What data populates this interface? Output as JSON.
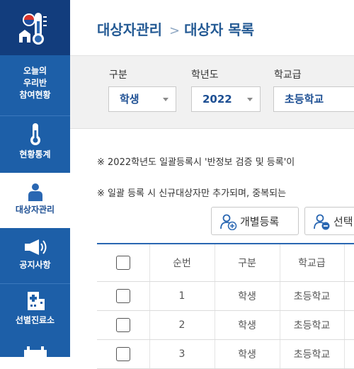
{
  "sidebar": {
    "items": [
      {
        "label_lines": [
          "오늘의",
          "우리반",
          "참여현황"
        ],
        "icon": "classroom-icon",
        "active": false
      },
      {
        "label": "현황통계",
        "icon": "thermometer-icon",
        "active": false
      },
      {
        "label": "대상자관리",
        "icon": "person-icon",
        "active": true
      },
      {
        "label": "공지사항",
        "icon": "megaphone-icon",
        "active": false
      },
      {
        "label": "선별진료소",
        "icon": "hospital-icon",
        "active": false
      }
    ],
    "logo_icon": "school-thermometer-logo-icon"
  },
  "header": {
    "crumb_parent": "대상자관리",
    "crumb_separator": ">",
    "crumb_current": "대상자 목록"
  },
  "filters": {
    "type": {
      "label": "구분",
      "value": "학생"
    },
    "year": {
      "label": "학년도",
      "value": "2022"
    },
    "school_level": {
      "label": "학교급",
      "value": "초등학교"
    }
  },
  "notices": [
    "※ 2022학년도 일괄등록시 '반정보 검증 및 등록'이",
    "※ 일괄 등록 시 신규대상자만 추가되며, 중복되는"
  ],
  "buttons": {
    "individual_register": "개별등록",
    "selected": "선택"
  },
  "table": {
    "headers": [
      "순번",
      "구분",
      "학교급"
    ],
    "rows": [
      {
        "no": "1",
        "type": "학생",
        "level": "초등학교"
      },
      {
        "no": "2",
        "type": "학생",
        "level": "초등학교"
      },
      {
        "no": "3",
        "type": "학생",
        "level": "초등학교"
      }
    ]
  },
  "colors": {
    "sidebar": "#1d5fa8",
    "logo_bg": "#123d7d",
    "accent_text": "#1d4f93"
  }
}
